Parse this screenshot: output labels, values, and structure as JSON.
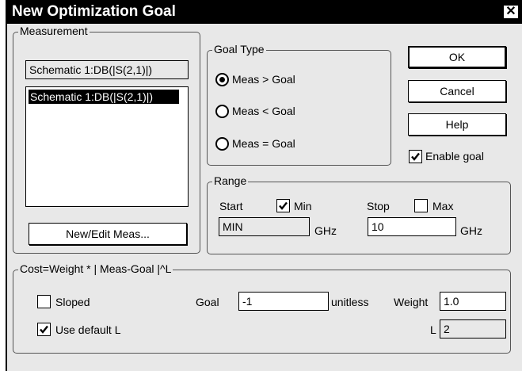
{
  "dialog": {
    "title": "New Optimization Goal",
    "close_glyph": "✕"
  },
  "measurement": {
    "legend": "Measurement",
    "current_value": "Schematic 1:DB(|S(2,1)|)",
    "list_items": [
      "Schematic 1:DB(|S(2,1)|)"
    ],
    "new_edit_label": "New/Edit Meas..."
  },
  "goal_type": {
    "legend": "Goal Type",
    "options": [
      {
        "label": "Meas > Goal",
        "selected": true
      },
      {
        "label": "Meas < Goal",
        "selected": false
      },
      {
        "label": "Meas = Goal",
        "selected": false
      }
    ]
  },
  "buttons": {
    "ok": "OK",
    "cancel": "Cancel",
    "help": "Help"
  },
  "enable_goal": {
    "label": "Enable goal",
    "checked": true
  },
  "range": {
    "legend": "Range",
    "start_label": "Start",
    "min_label": "Min",
    "min_checked": true,
    "start_value": "MIN",
    "start_unit": "GHz",
    "stop_label": "Stop",
    "max_label": "Max",
    "max_checked": false,
    "stop_value": "10",
    "stop_unit": "GHz"
  },
  "cost": {
    "legend": "Cost=Weight * | Meas-Goal |^L",
    "sloped_label": "Sloped",
    "sloped_checked": false,
    "use_default_l_label": "Use default L",
    "use_default_l_checked": true,
    "goal_label": "Goal",
    "goal_value": "-1",
    "goal_unit": "unitless",
    "weight_label": "Weight",
    "weight_value": "1.0",
    "l_label": "L",
    "l_value": "2"
  }
}
